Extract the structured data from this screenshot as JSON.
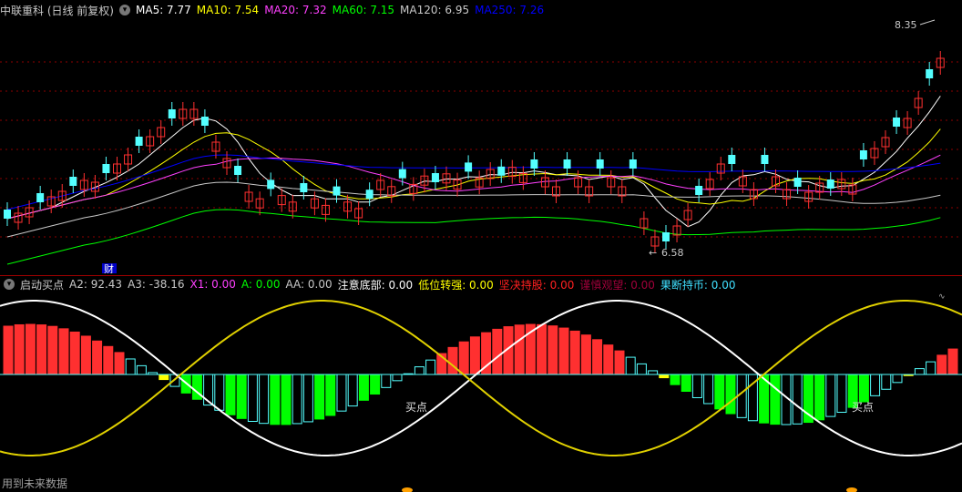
{
  "header": {
    "stock_title": "中联重科 (日线 前复权)",
    "ma": [
      {
        "label": "MA5: 7.77",
        "color": "#ffffff"
      },
      {
        "label": "MA10: 7.54",
        "color": "#ffff00"
      },
      {
        "label": "MA20: 7.32",
        "color": "#ff40ff"
      },
      {
        "label": "MA60: 7.15",
        "color": "#00ff00"
      },
      {
        "label": "MA120: 6.95",
        "color": "#c8c8c8"
      },
      {
        "label": "MA250: 7.26",
        "color": "#0000ff"
      }
    ]
  },
  "price_chart": {
    "high_marker": "8.35",
    "low_marker": "6.58",
    "finance_badge": "财"
  },
  "indicator": {
    "name": "启动买点",
    "values": [
      {
        "label": "A2: 92.43",
        "color": "#c8c8c8"
      },
      {
        "label": "A3: -38.16",
        "color": "#c8c8c8"
      },
      {
        "label": "X1: 0.00",
        "color": "#ff40ff"
      },
      {
        "label": "A: 0.00",
        "color": "#00ff00"
      },
      {
        "label": "AA: 0.00",
        "color": "#c8c8c8"
      },
      {
        "label": "注意底部: 0.00",
        "color": "#ffffff"
      },
      {
        "label": "低位转强: 0.00",
        "color": "#ffff00"
      },
      {
        "label": "坚决持股: 0.00",
        "color": "#ff2020"
      },
      {
        "label": "谨慎观望: 0.00",
        "color": "#a0003a"
      },
      {
        "label": "果断持币: 0.00",
        "color": "#40e0ff"
      }
    ],
    "buy_labels": [
      "买点",
      "买点"
    ]
  },
  "footer_note": "用到未来数据",
  "colors": {
    "up": "#ff3030",
    "down": "#54ffff",
    "grid": "#8b0000"
  }
}
